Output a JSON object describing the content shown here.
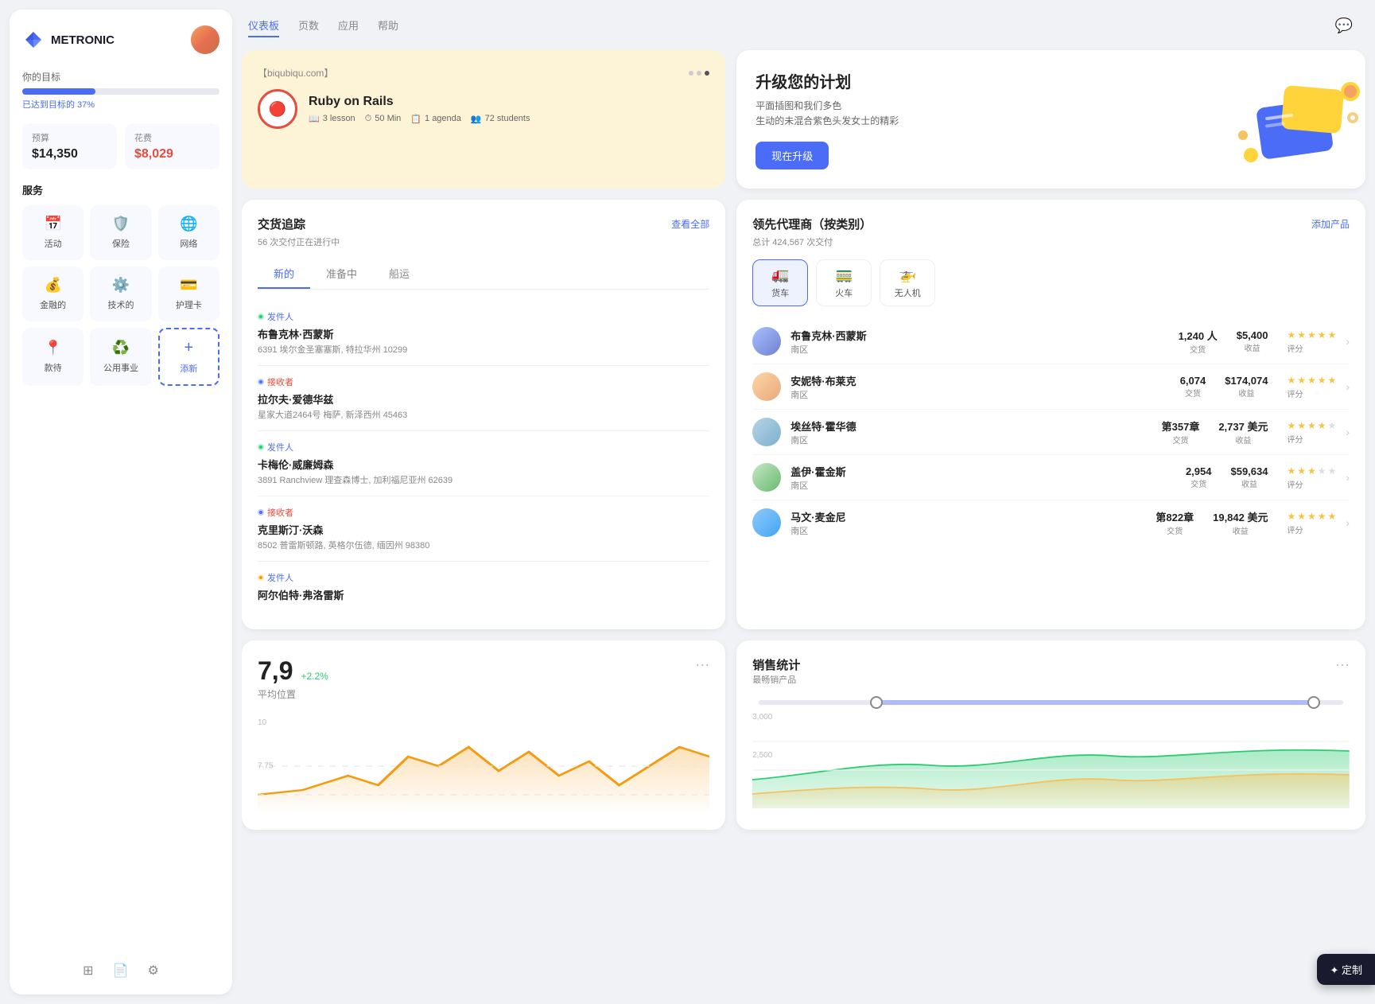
{
  "sidebar": {
    "logo": "METRONIC",
    "goal": {
      "label": "你的目标",
      "percent_text": "已达到目标的 37%",
      "fill_width": "37%"
    },
    "budget": {
      "budget_label": "预算",
      "budget_value": "$14,350",
      "expense_label": "花费",
      "expense_value": "$8,029"
    },
    "services_label": "服务",
    "services": [
      {
        "name": "活动",
        "icon": "📅"
      },
      {
        "name": "保险",
        "icon": "🛡️"
      },
      {
        "name": "网络",
        "icon": "🌐"
      },
      {
        "name": "金融的",
        "icon": "💰"
      },
      {
        "name": "技术的",
        "icon": "⚙️"
      },
      {
        "name": "护理卡",
        "icon": "💳"
      },
      {
        "name": "款待",
        "icon": "📍"
      },
      {
        "name": "公用事业",
        "icon": "♻️"
      },
      {
        "name": "添新",
        "icon": "+",
        "active": true
      }
    ],
    "bottom_icons": [
      "layers",
      "file",
      "settings"
    ]
  },
  "topnav": {
    "links": [
      "仪表板",
      "页数",
      "应用",
      "帮助"
    ],
    "active_link": "仪表板"
  },
  "course_card": {
    "url": "【biqubiqu.com】",
    "title": "Ruby on Rails",
    "lessons": "3 lesson",
    "duration": "50 Min",
    "agenda": "1 agenda",
    "students": "72 students",
    "dots": [
      "inactive",
      "inactive",
      "active"
    ]
  },
  "upgrade_card": {
    "title": "升级您的计划",
    "desc_line1": "平面插图和我们多色",
    "desc_line2": "生动的未混合紫色头发女士的精彩",
    "btn_label": "现在升级"
  },
  "delivery": {
    "title": "交货追踪",
    "subtitle": "56 次交付正在进行中",
    "link": "查看全部",
    "tabs": [
      "新的",
      "准备中",
      "船运"
    ],
    "active_tab": "新的",
    "items": [
      {
        "role": "发件人",
        "role_color": "green",
        "name": "布鲁克林·西蒙斯",
        "address": "6391 埃尔金圣塞塞斯, 特拉华州 10299"
      },
      {
        "role": "接收者",
        "role_color": "blue",
        "name": "拉尔夫·爱德华兹",
        "address": "星家大道2464号 梅萨, 新泽西州 45463"
      },
      {
        "role": "发件人",
        "role_color": "green",
        "name": "卡梅伦·威廉姆森",
        "address": "3891 Ranchview 理查森博士, 加利福尼亚州 62639"
      },
      {
        "role": "接收者",
        "role_color": "blue",
        "name": "克里斯汀·沃森",
        "address": "8502 普雷斯顿路, 英格尔伍德, 缅因州 98380"
      },
      {
        "role": "发件人",
        "role_color": "green",
        "name": "阿尔伯特·弗洛雷斯",
        "address": ""
      }
    ]
  },
  "top_agents": {
    "title": "领先代理商（按类别）",
    "subtitle": "总计 424,567 次交付",
    "add_btn": "添加产品",
    "tabs": [
      "货车",
      "火车",
      "无人机"
    ],
    "active_tab": "货车",
    "agents": [
      {
        "name": "布鲁克林·西蒙斯",
        "region": "南区",
        "transactions": "1,240 人",
        "revenue": "$5,400",
        "rating": 5,
        "tx_label": "交货",
        "rev_label": "收益",
        "rating_label": "评分"
      },
      {
        "name": "安妮特·布莱克",
        "region": "南区",
        "transactions": "6,074",
        "revenue": "$174,074",
        "rating": 5,
        "tx_label": "交货",
        "rev_label": "收益",
        "rating_label": "评分"
      },
      {
        "name": "埃丝特·霍华德",
        "region": "南区",
        "transactions": "第357章",
        "revenue": "2,737 美元",
        "rating": 4,
        "tx_label": "交货",
        "rev_label": "收益",
        "rating_label": "评分"
      },
      {
        "name": "盖伊·霍金斯",
        "region": "南区",
        "transactions": "2,954",
        "revenue": "$59,634",
        "rating": 3,
        "tx_label": "交货",
        "rev_label": "收益",
        "rating_label": "评分"
      },
      {
        "name": "马文·麦金尼",
        "region": "南区",
        "transactions": "第822章",
        "revenue": "19,842 美元",
        "rating": 5,
        "tx_label": "交货",
        "rev_label": "收益",
        "rating_label": "评分"
      }
    ]
  },
  "avg_position": {
    "value": "7,9",
    "trend": "+2.2%",
    "label": "平均位置",
    "y_labels": [
      "10",
      "7.75"
    ],
    "dots_label": "···"
  },
  "sales_stats": {
    "title": "销售统计",
    "subtitle": "最畅销产品",
    "y_labels": [
      "3,000",
      "2,500"
    ],
    "dots_label": "···"
  },
  "customize_btn": "✦ 定制"
}
